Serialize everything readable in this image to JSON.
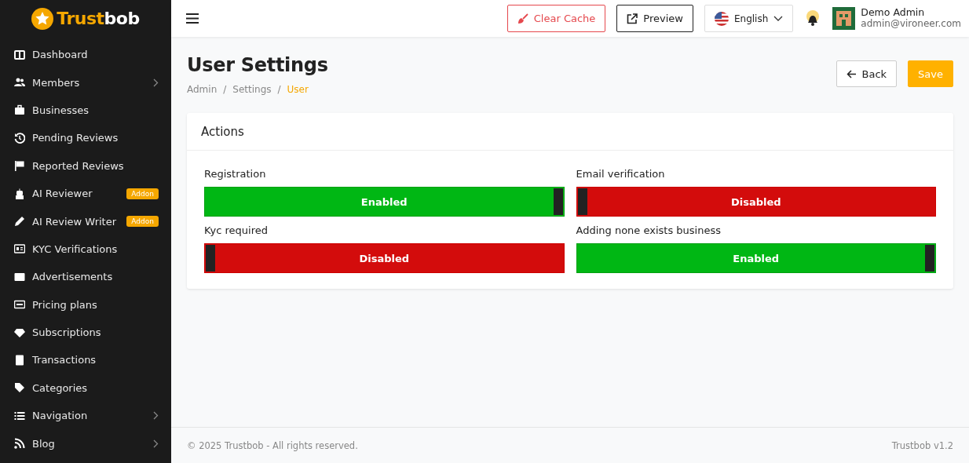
{
  "logo": {
    "primary": "Trust",
    "secondary": "bob"
  },
  "sidebar": {
    "items": [
      {
        "label": "Dashboard",
        "expandable": false
      },
      {
        "label": "Members",
        "expandable": true
      },
      {
        "label": "Businesses",
        "expandable": false
      },
      {
        "label": "Pending Reviews",
        "expandable": false
      },
      {
        "label": "Reported Reviews",
        "expandable": false
      },
      {
        "label": "AI Reviewer",
        "expandable": false,
        "badge": "Addon"
      },
      {
        "label": "AI Review Writer",
        "expandable": false,
        "badge": "Addon"
      },
      {
        "label": "KYC Verifications",
        "expandable": false
      },
      {
        "label": "Advertisements",
        "expandable": false
      },
      {
        "label": "Pricing plans",
        "expandable": false
      },
      {
        "label": "Subscriptions",
        "expandable": false
      },
      {
        "label": "Transactions",
        "expandable": false
      },
      {
        "label": "Categories",
        "expandable": false
      },
      {
        "label": "Navigation",
        "expandable": true
      },
      {
        "label": "Blog",
        "expandable": true
      }
    ]
  },
  "topbar": {
    "clear_cache": "Clear Cache",
    "preview": "Preview",
    "language": "English",
    "user": {
      "name": "Demo Admin",
      "email": "admin@vironeer.com"
    }
  },
  "page": {
    "title": "User Settings",
    "separator": "/",
    "breadcrumb": [
      {
        "label": "Admin",
        "selected": false
      },
      {
        "label": "Settings",
        "selected": false
      },
      {
        "label": "User",
        "selected": true
      }
    ],
    "back": "Back",
    "save": "Save"
  },
  "card": {
    "title": "Actions",
    "settings": [
      {
        "label": "Registration",
        "on": true,
        "state_text": "Enabled"
      },
      {
        "label": "Email verification",
        "on": false,
        "state_text": "Disabled"
      },
      {
        "label": "Kyc required",
        "on": false,
        "state_text": "Disabled"
      },
      {
        "label": "Adding none exists business",
        "on": true,
        "state_text": "Enabled"
      }
    ]
  },
  "footer": {
    "copyright": "© 2025 Trustbob - All rights reserved.",
    "version": "Trustbob v1.2"
  }
}
